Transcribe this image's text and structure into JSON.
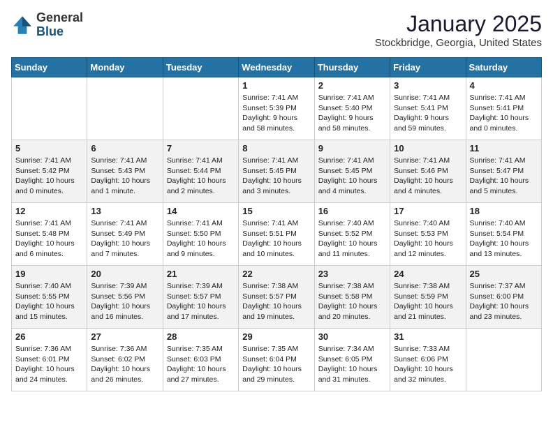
{
  "header": {
    "logo_general": "General",
    "logo_blue": "Blue",
    "month": "January 2025",
    "location": "Stockbridge, Georgia, United States"
  },
  "days_of_week": [
    "Sunday",
    "Monday",
    "Tuesday",
    "Wednesday",
    "Thursday",
    "Friday",
    "Saturday"
  ],
  "weeks": [
    [
      {
        "day": "",
        "info": ""
      },
      {
        "day": "",
        "info": ""
      },
      {
        "day": "",
        "info": ""
      },
      {
        "day": "1",
        "info": "Sunrise: 7:41 AM\nSunset: 5:39 PM\nDaylight: 9 hours\nand 58 minutes."
      },
      {
        "day": "2",
        "info": "Sunrise: 7:41 AM\nSunset: 5:40 PM\nDaylight: 9 hours\nand 58 minutes."
      },
      {
        "day": "3",
        "info": "Sunrise: 7:41 AM\nSunset: 5:41 PM\nDaylight: 9 hours\nand 59 minutes."
      },
      {
        "day": "4",
        "info": "Sunrise: 7:41 AM\nSunset: 5:41 PM\nDaylight: 10 hours\nand 0 minutes."
      }
    ],
    [
      {
        "day": "5",
        "info": "Sunrise: 7:41 AM\nSunset: 5:42 PM\nDaylight: 10 hours\nand 0 minutes."
      },
      {
        "day": "6",
        "info": "Sunrise: 7:41 AM\nSunset: 5:43 PM\nDaylight: 10 hours\nand 1 minute."
      },
      {
        "day": "7",
        "info": "Sunrise: 7:41 AM\nSunset: 5:44 PM\nDaylight: 10 hours\nand 2 minutes."
      },
      {
        "day": "8",
        "info": "Sunrise: 7:41 AM\nSunset: 5:45 PM\nDaylight: 10 hours\nand 3 minutes."
      },
      {
        "day": "9",
        "info": "Sunrise: 7:41 AM\nSunset: 5:45 PM\nDaylight: 10 hours\nand 4 minutes."
      },
      {
        "day": "10",
        "info": "Sunrise: 7:41 AM\nSunset: 5:46 PM\nDaylight: 10 hours\nand 4 minutes."
      },
      {
        "day": "11",
        "info": "Sunrise: 7:41 AM\nSunset: 5:47 PM\nDaylight: 10 hours\nand 5 minutes."
      }
    ],
    [
      {
        "day": "12",
        "info": "Sunrise: 7:41 AM\nSunset: 5:48 PM\nDaylight: 10 hours\nand 6 minutes."
      },
      {
        "day": "13",
        "info": "Sunrise: 7:41 AM\nSunset: 5:49 PM\nDaylight: 10 hours\nand 7 minutes."
      },
      {
        "day": "14",
        "info": "Sunrise: 7:41 AM\nSunset: 5:50 PM\nDaylight: 10 hours\nand 9 minutes."
      },
      {
        "day": "15",
        "info": "Sunrise: 7:41 AM\nSunset: 5:51 PM\nDaylight: 10 hours\nand 10 minutes."
      },
      {
        "day": "16",
        "info": "Sunrise: 7:40 AM\nSunset: 5:52 PM\nDaylight: 10 hours\nand 11 minutes."
      },
      {
        "day": "17",
        "info": "Sunrise: 7:40 AM\nSunset: 5:53 PM\nDaylight: 10 hours\nand 12 minutes."
      },
      {
        "day": "18",
        "info": "Sunrise: 7:40 AM\nSunset: 5:54 PM\nDaylight: 10 hours\nand 13 minutes."
      }
    ],
    [
      {
        "day": "19",
        "info": "Sunrise: 7:40 AM\nSunset: 5:55 PM\nDaylight: 10 hours\nand 15 minutes."
      },
      {
        "day": "20",
        "info": "Sunrise: 7:39 AM\nSunset: 5:56 PM\nDaylight: 10 hours\nand 16 minutes."
      },
      {
        "day": "21",
        "info": "Sunrise: 7:39 AM\nSunset: 5:57 PM\nDaylight: 10 hours\nand 17 minutes."
      },
      {
        "day": "22",
        "info": "Sunrise: 7:38 AM\nSunset: 5:57 PM\nDaylight: 10 hours\nand 19 minutes."
      },
      {
        "day": "23",
        "info": "Sunrise: 7:38 AM\nSunset: 5:58 PM\nDaylight: 10 hours\nand 20 minutes."
      },
      {
        "day": "24",
        "info": "Sunrise: 7:38 AM\nSunset: 5:59 PM\nDaylight: 10 hours\nand 21 minutes."
      },
      {
        "day": "25",
        "info": "Sunrise: 7:37 AM\nSunset: 6:00 PM\nDaylight: 10 hours\nand 23 minutes."
      }
    ],
    [
      {
        "day": "26",
        "info": "Sunrise: 7:36 AM\nSunset: 6:01 PM\nDaylight: 10 hours\nand 24 minutes."
      },
      {
        "day": "27",
        "info": "Sunrise: 7:36 AM\nSunset: 6:02 PM\nDaylight: 10 hours\nand 26 minutes."
      },
      {
        "day": "28",
        "info": "Sunrise: 7:35 AM\nSunset: 6:03 PM\nDaylight: 10 hours\nand 27 minutes."
      },
      {
        "day": "29",
        "info": "Sunrise: 7:35 AM\nSunset: 6:04 PM\nDaylight: 10 hours\nand 29 minutes."
      },
      {
        "day": "30",
        "info": "Sunrise: 7:34 AM\nSunset: 6:05 PM\nDaylight: 10 hours\nand 31 minutes."
      },
      {
        "day": "31",
        "info": "Sunrise: 7:33 AM\nSunset: 6:06 PM\nDaylight: 10 hours\nand 32 minutes."
      },
      {
        "day": "",
        "info": ""
      }
    ]
  ]
}
